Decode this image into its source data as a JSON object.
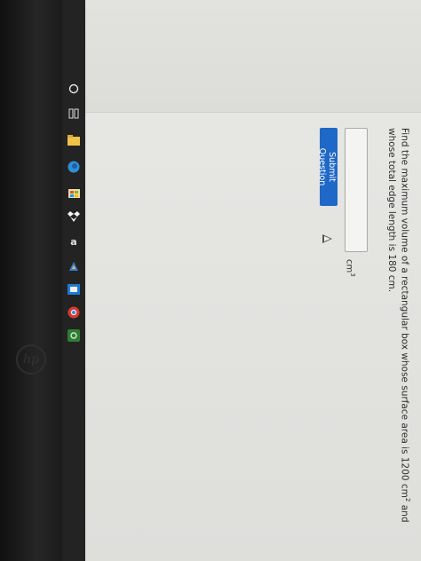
{
  "question": {
    "text_part1": "Find the maximum volume of a rectangular box whose surface area is 1200 cm",
    "sup1": "2",
    "text_part2": " and whose total edge length is 180 cm."
  },
  "answer": {
    "value": "",
    "unit": "cm",
    "unit_sup": "3"
  },
  "submit_label": "Submit Question",
  "taskbar": {
    "icons": [
      "search-icon",
      "task-view-icon",
      "file-explorer-icon",
      "edge-icon",
      "store-icon",
      "dropbox-icon",
      "amazon-icon",
      "steam-icon",
      "mail-icon",
      "chrome-icon",
      "xbox-icon"
    ],
    "amazon_label": "a"
  },
  "bezel_logo": "hp",
  "colors": {
    "submit_bg": "#1f68c8",
    "page_bg": "#e9e9e6"
  }
}
